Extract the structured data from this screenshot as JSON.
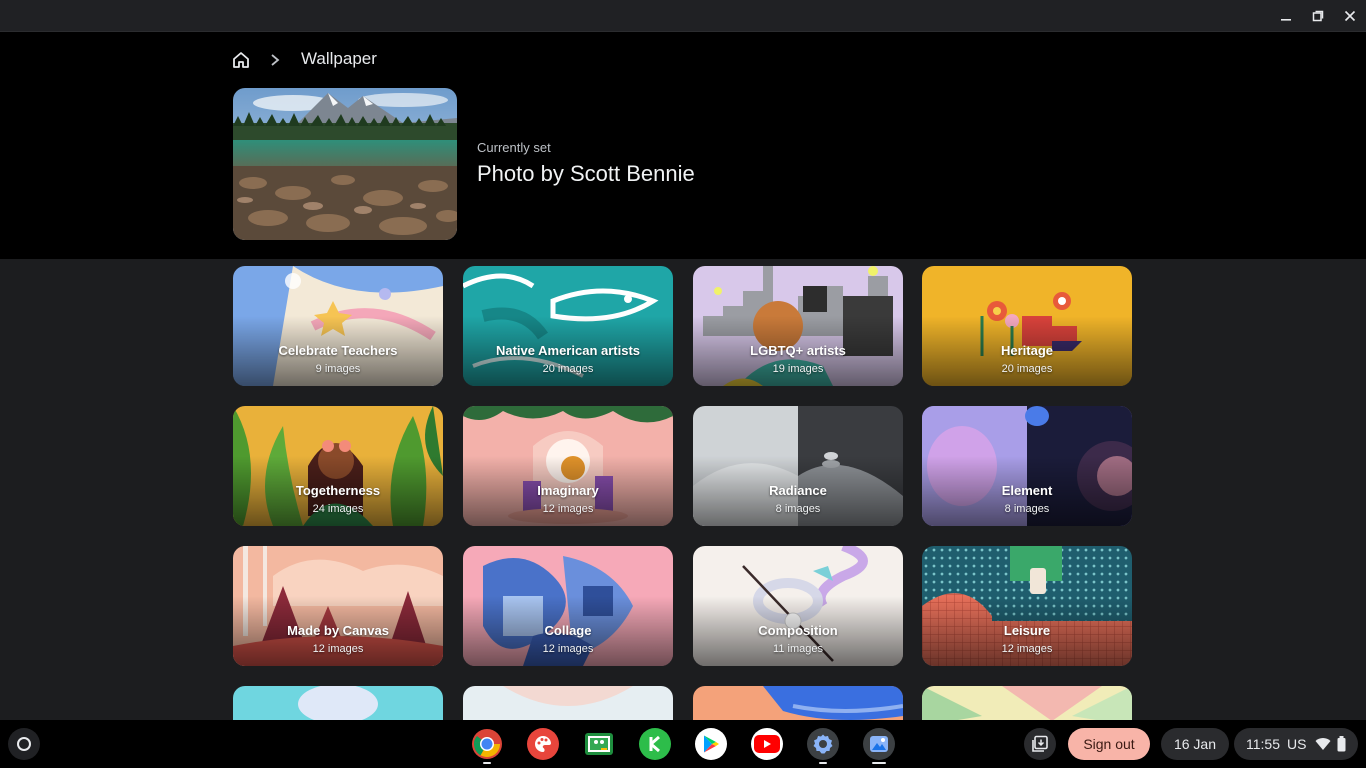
{
  "window": {
    "minimize_icon": "minimize-icon",
    "maximize_icon": "restore-icon",
    "close_icon": "close-icon"
  },
  "breadcrumb": {
    "home_icon": "home-icon",
    "separator_icon": "chevron-right-icon",
    "title": "Wallpaper"
  },
  "current": {
    "label": "Currently set",
    "title": "Photo by Scott Bennie"
  },
  "collections": [
    {
      "name": "Celebrate Teachers",
      "count": "9 images"
    },
    {
      "name": "Native American artists",
      "count": "20 images"
    },
    {
      "name": "LGBTQ+ artists",
      "count": "19 images"
    },
    {
      "name": "Heritage",
      "count": "20 images"
    },
    {
      "name": "Togetherness",
      "count": "24 images"
    },
    {
      "name": "Imaginary",
      "count": "12 images"
    },
    {
      "name": "Radiance",
      "count": "8 images"
    },
    {
      "name": "Element",
      "count": "8 images"
    },
    {
      "name": "Made by Canvas",
      "count": "12 images"
    },
    {
      "name": "Collage",
      "count": "12 images"
    },
    {
      "name": "Composition",
      "count": "11 images"
    },
    {
      "name": "Leisure",
      "count": "12 images"
    },
    {
      "name": "",
      "count": ""
    },
    {
      "name": "",
      "count": ""
    },
    {
      "name": "",
      "count": ""
    },
    {
      "name": "",
      "count": ""
    }
  ],
  "shelf": {
    "launcher_icon": "launcher-icon",
    "apps": [
      "chrome-icon",
      "canvas-icon",
      "classroom-icon",
      "kahoot-icon",
      "play-store-icon",
      "youtube-icon",
      "settings-icon",
      "wallpaper-icon"
    ],
    "holding_space_icon": "holding-space-icon",
    "sign_out": "Sign out",
    "date": "16 Jan",
    "time": "11:55",
    "locale": "US",
    "wifi_icon": "wifi-icon",
    "battery_icon": "battery-icon"
  }
}
